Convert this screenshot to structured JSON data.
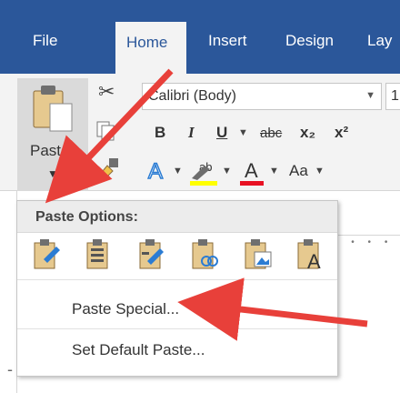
{
  "ribbon": {
    "tabs": [
      "File",
      "Home",
      "Insert",
      "Design",
      "Lay"
    ],
    "font_name": "Calibri (Body)",
    "font_size": "1",
    "format_bold": "B",
    "format_italic": "I",
    "format_underline": "U",
    "strikethrough": "abc",
    "subscript": "x₂",
    "superscript": "x²",
    "change_case": "Aa",
    "paste_label": "Paste"
  },
  "menu": {
    "title": "Paste Options:",
    "item_special": "Paste Special...",
    "item_default": "Set Default Paste..."
  },
  "colors": {
    "brand": "#2b579a",
    "arrow": "#e8403a",
    "highlight_yellow": "#ffff00",
    "font_red": "#e81123"
  },
  "icons": [
    "scissors-icon",
    "copy-icon",
    "format-painter-icon",
    "clipboard-icon",
    "text-effects-icon",
    "highlight-icon",
    "font-color-icon"
  ]
}
